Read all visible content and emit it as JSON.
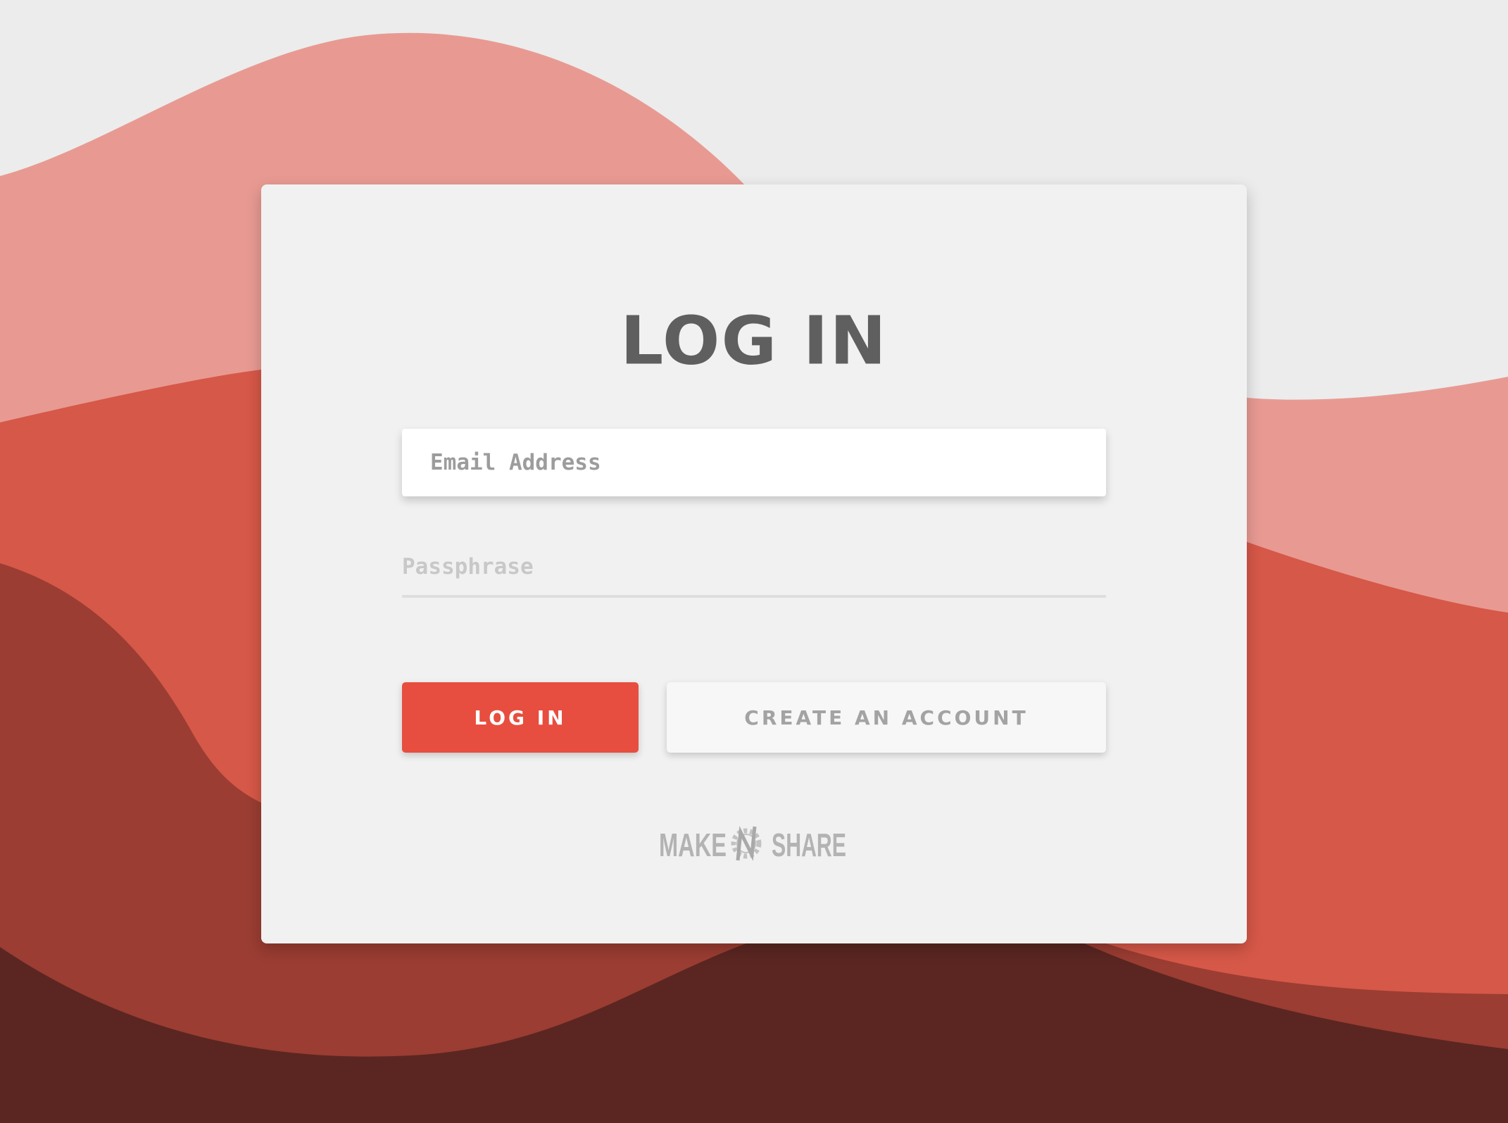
{
  "login": {
    "title": "LOG IN",
    "email_placeholder": "Email Address",
    "passphrase_placeholder": "Passphrase",
    "login_button_label": "LOG IN",
    "create_account_label": "CREATE AN ACCOUNT"
  },
  "brand": {
    "left_word": "MAKE",
    "right_word": "SHARE"
  },
  "colors": {
    "accent": "#e74e3f",
    "background": "#ececec",
    "card": "#f1f1f1",
    "wave_light": "#e89a92",
    "wave_mid": "#d65848",
    "wave_dark": "#9b3d32",
    "wave_darkest": "#5b2622"
  }
}
